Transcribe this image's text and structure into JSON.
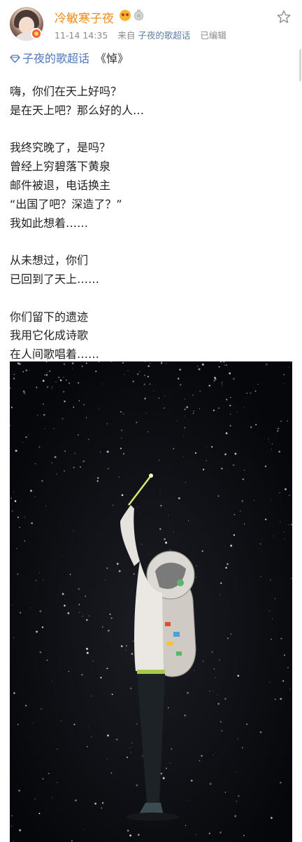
{
  "post": {
    "user": {
      "name": "冷敏寒子夜"
    },
    "timestamp": "11-14 14:35",
    "source_prefix": "来自",
    "source_name": "子夜的歌超话",
    "edited_label": "已编辑",
    "topic": "子夜的歌超话",
    "title": "《悼》",
    "poem_lines": [
      "嗨，你们在天上好吗？",
      "是在天上吧？那么好的人…",
      "",
      "我终究晚了，是吗？",
      "曾经上穷碧落下黄泉",
      "邮件被退，电话换主",
      "“出国了吧？深造了？”",
      "我如此想着……",
      "",
      "从未想过，你们",
      "已回到了天上……",
      "",
      "你们留下的遗迹",
      "我用它化成诗歌",
      "在人间歌唱着……"
    ]
  },
  "icons": {
    "avatar": "user-avatar",
    "verified": "verified-badge-icon",
    "vip": "vip-face-icon",
    "medal": "medal-icon",
    "favorite": "star-icon",
    "topic": "super-topic-diamond-icon"
  },
  "colors": {
    "username": "#f08a1e",
    "link": "#4d77b8",
    "meta": "#8b8b8b",
    "photo_background": "#07080b"
  },
  "image": {
    "description_label": "starry-sky-astronaut-illustration"
  }
}
